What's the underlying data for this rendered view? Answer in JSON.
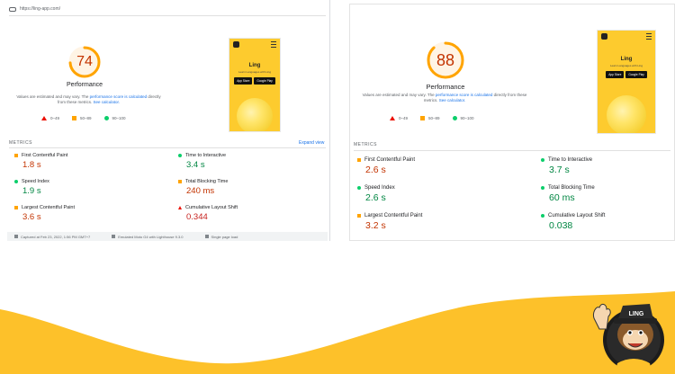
{
  "left": {
    "url": "https://ling-app.com/",
    "score": "74",
    "score_percent": 74,
    "performance_label": "Performance",
    "desc_prefix": "Values are estimated and may vary. The ",
    "desc_link": "performance score is calculated",
    "desc_middle": " directly from these metrics. ",
    "desc_calc": "See calculator.",
    "legend": [
      "0–49",
      "50–89",
      "90–100"
    ],
    "metrics_label": "METRICS",
    "expand_label": "Expand view",
    "metrics": [
      {
        "name": "First Contentful Paint",
        "value": "1.8 s"
      },
      {
        "name": "Time to Interactive",
        "value": "3.4 s"
      },
      {
        "name": "Speed Index",
        "value": "1.9 s"
      },
      {
        "name": "Total Blocking Time",
        "value": "240 ms"
      },
      {
        "name": "Largest Contentful Paint",
        "value": "3.6 s"
      },
      {
        "name": "Cumulative Layout Shift",
        "value": "0.344"
      }
    ],
    "footer": [
      "Captured at Feb 23, 2022, 1:56 PM GMT+7",
      "Emulated Moto G4 with Lighthouse 9.3.0",
      "Single page load"
    ]
  },
  "right": {
    "score": "88",
    "score_percent": 88,
    "performance_label": "Performance",
    "desc_prefix": "Values are estimated and may vary. The ",
    "desc_link": "performance score is calculated",
    "desc_middle": " directly from these metrics. ",
    "desc_calc": "See calculator.",
    "legend": [
      "0–49",
      "50–89",
      "90–100"
    ],
    "metrics_label": "METRICS",
    "metrics": [
      {
        "name": "First Contentful Paint",
        "value": "2.6 s"
      },
      {
        "name": "Time to Interactive",
        "value": "3.7 s"
      },
      {
        "name": "Speed Index",
        "value": "2.6 s"
      },
      {
        "name": "Total Blocking Time",
        "value": "60 ms"
      },
      {
        "name": "Largest Contentful Paint",
        "value": "3.2 s"
      },
      {
        "name": "Cumulative Layout Shift",
        "value": "0.038"
      }
    ]
  },
  "phone": {
    "title": "Ling",
    "subtitle": "Learn Languages with Ling",
    "app_store": "App Store",
    "google_play": "Google Play"
  },
  "mascot": {
    "hat_text": "LING"
  },
  "colors": {
    "orange": "#ffa400",
    "green": "#0cce6b",
    "red": "#eb0f00",
    "wave": "#fdc12a",
    "link": "#1a73e8"
  }
}
